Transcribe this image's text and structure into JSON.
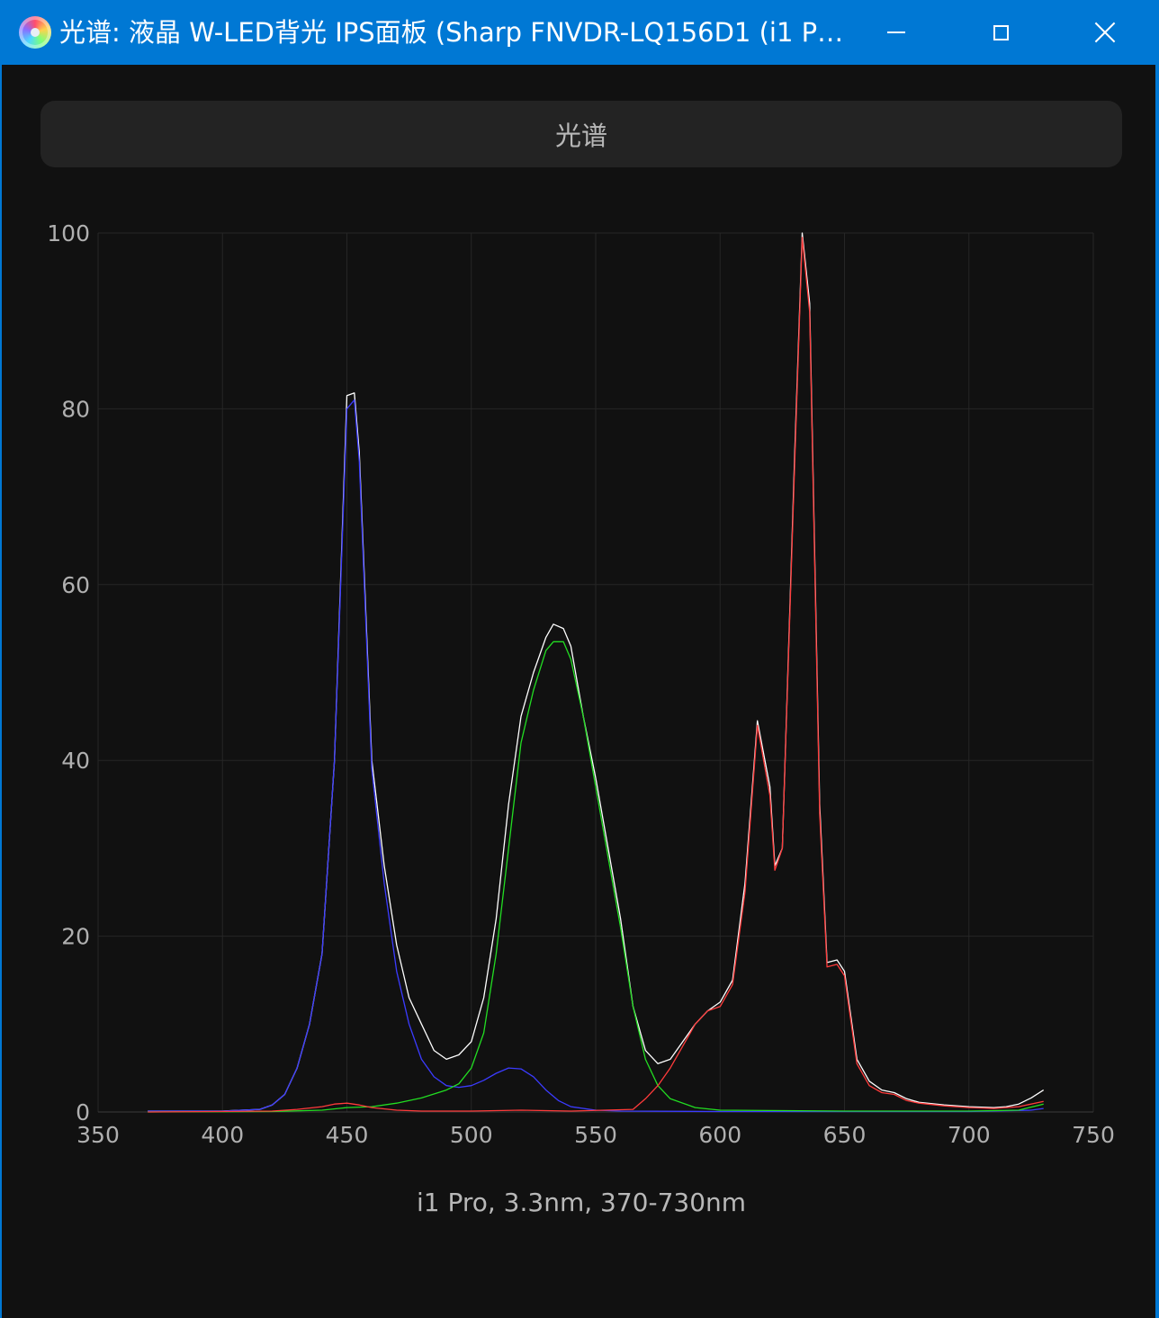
{
  "window": {
    "title": "光谱: 液晶 W-LED背光 IPS面板 (Sharp FNVDR-LQ156D1 (i1 P…",
    "icon": "spectrum-disc-icon",
    "controls": [
      "minimize-icon",
      "maximize-icon",
      "close-icon"
    ]
  },
  "tab": {
    "label": "光谱"
  },
  "footer": {
    "label": "i1 Pro, 3.3nm, 370-730nm"
  },
  "chart_data": {
    "type": "line",
    "title": "",
    "xlabel": "",
    "ylabel": "",
    "xlim": [
      350,
      750
    ],
    "ylim": [
      0,
      100
    ],
    "x_ticks": [
      350,
      400,
      450,
      500,
      550,
      600,
      650,
      700,
      750
    ],
    "y_ticks": [
      0,
      20,
      40,
      60,
      80,
      100
    ],
    "grid": true,
    "legend": "none",
    "series": [
      {
        "color": "#ffffff",
        "points": [
          [
            370,
            0.1
          ],
          [
            400,
            0.1
          ],
          [
            415,
            0.3
          ],
          [
            420,
            0.8
          ],
          [
            425,
            2
          ],
          [
            430,
            5
          ],
          [
            435,
            10
          ],
          [
            440,
            18
          ],
          [
            445,
            40
          ],
          [
            450,
            81.5
          ],
          [
            453,
            81.8
          ],
          [
            455,
            75
          ],
          [
            460,
            40
          ],
          [
            465,
            28
          ],
          [
            470,
            19
          ],
          [
            475,
            13
          ],
          [
            480,
            10
          ],
          [
            485,
            7
          ],
          [
            490,
            6
          ],
          [
            495,
            6.5
          ],
          [
            500,
            8
          ],
          [
            505,
            13
          ],
          [
            510,
            22
          ],
          [
            515,
            35
          ],
          [
            520,
            45
          ],
          [
            525,
            50
          ],
          [
            530,
            54
          ],
          [
            533,
            55.5
          ],
          [
            537,
            55
          ],
          [
            540,
            53
          ],
          [
            545,
            45
          ],
          [
            550,
            38
          ],
          [
            555,
            30
          ],
          [
            560,
            22
          ],
          [
            565,
            12
          ],
          [
            570,
            7
          ],
          [
            575,
            5.5
          ],
          [
            580,
            6
          ],
          [
            585,
            8
          ],
          [
            590,
            10
          ],
          [
            595,
            11.5
          ],
          [
            600,
            12.5
          ],
          [
            605,
            15
          ],
          [
            610,
            26
          ],
          [
            615,
            44.5
          ],
          [
            620,
            37
          ],
          [
            622,
            28
          ],
          [
            625,
            30
          ],
          [
            630,
            75
          ],
          [
            633,
            100
          ],
          [
            636,
            92
          ],
          [
            640,
            35
          ],
          [
            643,
            17
          ],
          [
            647,
            17.3
          ],
          [
            650,
            16
          ],
          [
            655,
            6
          ],
          [
            660,
            3.5
          ],
          [
            665,
            2.5
          ],
          [
            670,
            2.2
          ],
          [
            675,
            1.5
          ],
          [
            680,
            1.1
          ],
          [
            690,
            0.8
          ],
          [
            700,
            0.6
          ],
          [
            710,
            0.5
          ],
          [
            715,
            0.6
          ],
          [
            720,
            0.9
          ],
          [
            725,
            1.6
          ],
          [
            730,
            2.5
          ]
        ]
      },
      {
        "color": "#3b3bff",
        "points": [
          [
            370,
            0.1
          ],
          [
            400,
            0.1
          ],
          [
            415,
            0.3
          ],
          [
            420,
            0.8
          ],
          [
            425,
            2
          ],
          [
            430,
            5
          ],
          [
            435,
            10
          ],
          [
            440,
            18
          ],
          [
            445,
            40
          ],
          [
            450,
            80
          ],
          [
            453,
            81
          ],
          [
            455,
            74
          ],
          [
            460,
            39
          ],
          [
            465,
            26
          ],
          [
            470,
            16
          ],
          [
            475,
            10
          ],
          [
            480,
            6
          ],
          [
            485,
            4
          ],
          [
            490,
            3
          ],
          [
            495,
            2.8
          ],
          [
            500,
            3
          ],
          [
            505,
            3.6
          ],
          [
            510,
            4.4
          ],
          [
            515,
            5
          ],
          [
            520,
            4.9
          ],
          [
            525,
            4
          ],
          [
            530,
            2.5
          ],
          [
            535,
            1.3
          ],
          [
            540,
            0.6
          ],
          [
            550,
            0.2
          ],
          [
            560,
            0.1
          ],
          [
            600,
            0.05
          ],
          [
            650,
            0.05
          ],
          [
            700,
            0.05
          ],
          [
            725,
            0.2
          ],
          [
            730,
            0.4
          ]
        ]
      },
      {
        "color": "#22dd22",
        "points": [
          [
            370,
            0
          ],
          [
            420,
            0.05
          ],
          [
            440,
            0.2
          ],
          [
            450,
            0.5
          ],
          [
            460,
            0.6
          ],
          [
            470,
            1
          ],
          [
            480,
            1.6
          ],
          [
            490,
            2.5
          ],
          [
            495,
            3.2
          ],
          [
            500,
            5
          ],
          [
            505,
            9
          ],
          [
            510,
            18
          ],
          [
            515,
            30
          ],
          [
            520,
            42
          ],
          [
            525,
            48
          ],
          [
            530,
            52.5
          ],
          [
            533,
            53.5
          ],
          [
            537,
            53.5
          ],
          [
            540,
            51.5
          ],
          [
            545,
            45
          ],
          [
            550,
            37
          ],
          [
            555,
            29
          ],
          [
            560,
            21
          ],
          [
            565,
            12
          ],
          [
            570,
            6
          ],
          [
            575,
            3
          ],
          [
            580,
            1.5
          ],
          [
            590,
            0.5
          ],
          [
            600,
            0.2
          ],
          [
            650,
            0.1
          ],
          [
            700,
            0.1
          ],
          [
            720,
            0.2
          ],
          [
            730,
            0.9
          ]
        ]
      },
      {
        "color": "#ff3b3b",
        "points": [
          [
            370,
            0
          ],
          [
            420,
            0.1
          ],
          [
            430,
            0.3
          ],
          [
            440,
            0.6
          ],
          [
            445,
            0.9
          ],
          [
            450,
            1
          ],
          [
            455,
            0.8
          ],
          [
            460,
            0.5
          ],
          [
            470,
            0.2
          ],
          [
            480,
            0.1
          ],
          [
            500,
            0.1
          ],
          [
            520,
            0.2
          ],
          [
            540,
            0.1
          ],
          [
            565,
            0.3
          ],
          [
            570,
            1.5
          ],
          [
            575,
            3
          ],
          [
            580,
            5
          ],
          [
            585,
            7.5
          ],
          [
            590,
            10
          ],
          [
            595,
            11.5
          ],
          [
            600,
            12
          ],
          [
            605,
            14.5
          ],
          [
            610,
            25
          ],
          [
            615,
            44
          ],
          [
            620,
            36
          ],
          [
            622,
            27.5
          ],
          [
            625,
            30
          ],
          [
            630,
            74
          ],
          [
            633,
            99.5
          ],
          [
            636,
            91
          ],
          [
            640,
            34
          ],
          [
            643,
            16.5
          ],
          [
            647,
            16.8
          ],
          [
            650,
            15.5
          ],
          [
            655,
            5.5
          ],
          [
            660,
            3
          ],
          [
            665,
            2.2
          ],
          [
            670,
            2
          ],
          [
            675,
            1.3
          ],
          [
            680,
            1
          ],
          [
            690,
            0.7
          ],
          [
            700,
            0.5
          ],
          [
            710,
            0.4
          ],
          [
            720,
            0.6
          ],
          [
            730,
            1.2
          ]
        ]
      }
    ]
  }
}
